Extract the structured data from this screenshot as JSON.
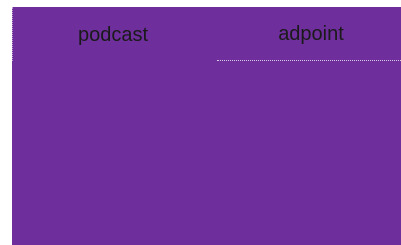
{
  "tabs": [
    {
      "label": "podcast",
      "active": true
    },
    {
      "label": "adpoint",
      "active": false
    }
  ],
  "colors": {
    "panel_background": "#6e2e9b",
    "tab_text": "#1a1a1a"
  }
}
